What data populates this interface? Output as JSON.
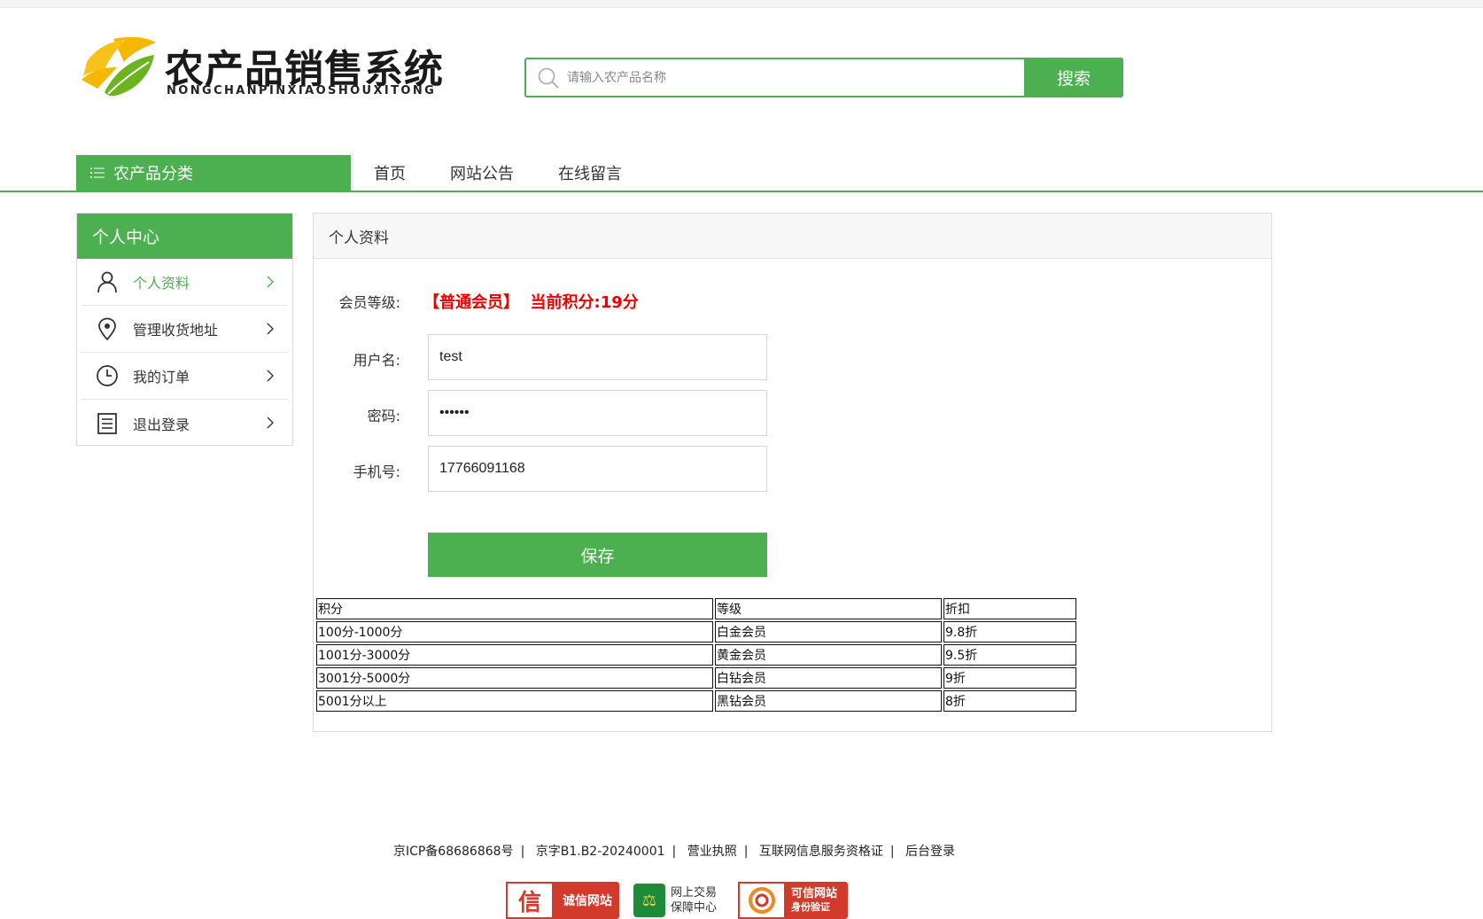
{
  "header": {
    "title": "农产品销售系统",
    "subtitle": "NONGCHANPINXIAOSHOUXITONG",
    "search_placeholder": "请输入农产品名称",
    "search_button": "搜索"
  },
  "nav": {
    "category_label": "农产品分类",
    "links": [
      "首页",
      "网站公告",
      "在线留言"
    ]
  },
  "sidebar": {
    "title": "个人中心",
    "items": [
      {
        "label": "个人资料",
        "icon": "user-icon",
        "active": true
      },
      {
        "label": "管理收货地址",
        "icon": "location-icon",
        "active": false
      },
      {
        "label": "我的订单",
        "icon": "clock-icon",
        "active": false
      },
      {
        "label": "退出登录",
        "icon": "document-icon",
        "active": false
      }
    ]
  },
  "profile": {
    "section_title": "个人资料",
    "member_label": "会员等级:",
    "member_value": "【普通会员】  当前积分:19分",
    "username_label": "用户名:",
    "username_value": "test",
    "password_label": "密码:",
    "password_value": "123456",
    "phone_label": "手机号:",
    "phone_value": "17766091168",
    "save_button": "保存"
  },
  "levels_table": {
    "headers": [
      "积分",
      "等级",
      "折扣"
    ],
    "rows": [
      [
        "100分-1000分",
        "白金会员",
        "9.8折"
      ],
      [
        "1001分-3000分",
        "黄金会员",
        "9.5折"
      ],
      [
        "3001分-5000分",
        "白钻会员",
        "9折"
      ],
      [
        "5001分以上",
        "黑钻会员",
        "8折"
      ]
    ]
  },
  "footer": {
    "links": [
      "京ICP备68686868号",
      "京字B1.B2-20240001",
      "营业执照",
      "互联网信息服务资格证",
      "后台登录"
    ],
    "badges": {
      "b1_mark": "信",
      "b1_text": "诚信网站",
      "b2_line1": "网上交易",
      "b2_line2": "保障中心",
      "b3_line1": "可信网站",
      "b3_line2": "身份验证"
    }
  },
  "colors": {
    "accent": "#4caf50",
    "member": "#e00000"
  }
}
